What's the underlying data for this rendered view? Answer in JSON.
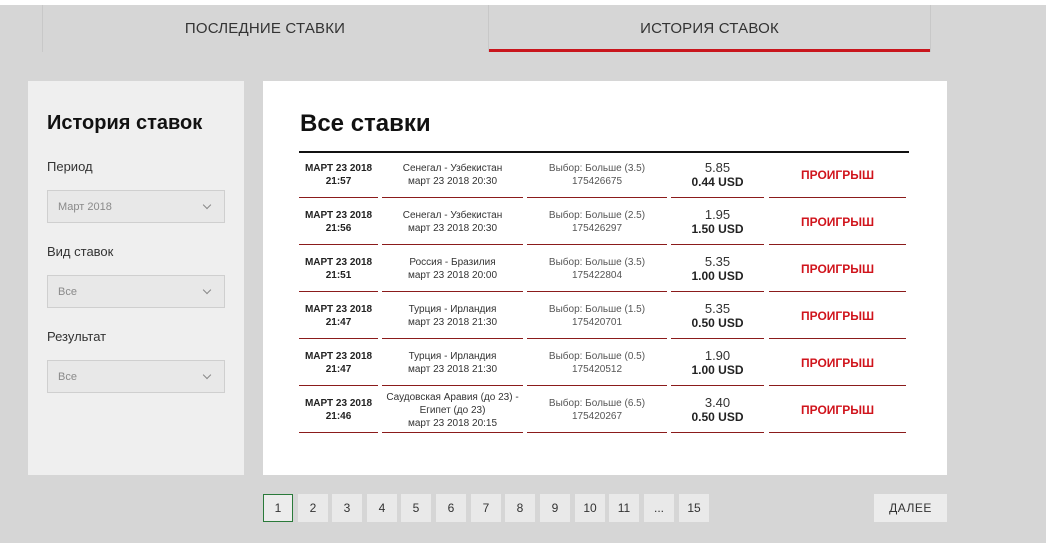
{
  "tabs": [
    {
      "label": "ПОСЛЕДНИЕ СТАВКИ"
    },
    {
      "label": "ИСТОРИЯ СТАВОК"
    }
  ],
  "sidebar": {
    "title": "История ставок",
    "period_label": "Период",
    "period_value": "Март 2018",
    "type_label": "Вид ставок",
    "type_value": "Все",
    "result_label": "Результат",
    "result_value": "Все"
  },
  "main": {
    "title": "Все ставки",
    "bets": [
      {
        "date": "МАРТ 23 2018",
        "time": "21:57",
        "match": "Сенегал - Узбекистан",
        "match_time": "март 23 2018 20:30",
        "selection": "Выбор: Больше (3.5)",
        "bet_id": "175426675",
        "odds": "5.85",
        "amount": "0.44 USD",
        "result": "ПРОИГРЫШ"
      },
      {
        "date": "МАРТ 23 2018",
        "time": "21:56",
        "match": "Сенегал - Узбекистан",
        "match_time": "март 23 2018 20:30",
        "selection": "Выбор: Больше (2.5)",
        "bet_id": "175426297",
        "odds": "1.95",
        "amount": "1.50 USD",
        "result": "ПРОИГРЫШ"
      },
      {
        "date": "МАРТ 23 2018",
        "time": "21:51",
        "match": "Россия - Бразилия",
        "match_time": "март 23 2018 20:00",
        "selection": "Выбор: Больше (3.5)",
        "bet_id": "175422804",
        "odds": "5.35",
        "amount": "1.00 USD",
        "result": "ПРОИГРЫШ"
      },
      {
        "date": "МАРТ 23 2018",
        "time": "21:47",
        "match": "Турция - Ирландия",
        "match_time": "март 23 2018 21:30",
        "selection": "Выбор: Больше (1.5)",
        "bet_id": "175420701",
        "odds": "5.35",
        "amount": "0.50 USD",
        "result": "ПРОИГРЫШ"
      },
      {
        "date": "МАРТ 23 2018",
        "time": "21:47",
        "match": "Турция - Ирландия",
        "match_time": "март 23 2018 21:30",
        "selection": "Выбор: Больше (0.5)",
        "bet_id": "175420512",
        "odds": "1.90",
        "amount": "1.00 USD",
        "result": "ПРОИГРЫШ"
      },
      {
        "date": "МАРТ 23 2018",
        "time": "21:46",
        "match": "Саудовская Аравия (до 23) - Египет (до 23)",
        "match_time": "март 23 2018 20:15",
        "selection": "Выбор: Больше (6.5)",
        "bet_id": "175420267",
        "odds": "3.40",
        "amount": "0.50 USD",
        "result": "ПРОИГРЫШ"
      }
    ]
  },
  "pagination": {
    "pages": [
      "1",
      "2",
      "3",
      "4",
      "5",
      "6",
      "7",
      "8",
      "9",
      "10",
      "11",
      "...",
      "15"
    ],
    "current": "1",
    "next_label": "ДАЛЕЕ"
  }
}
